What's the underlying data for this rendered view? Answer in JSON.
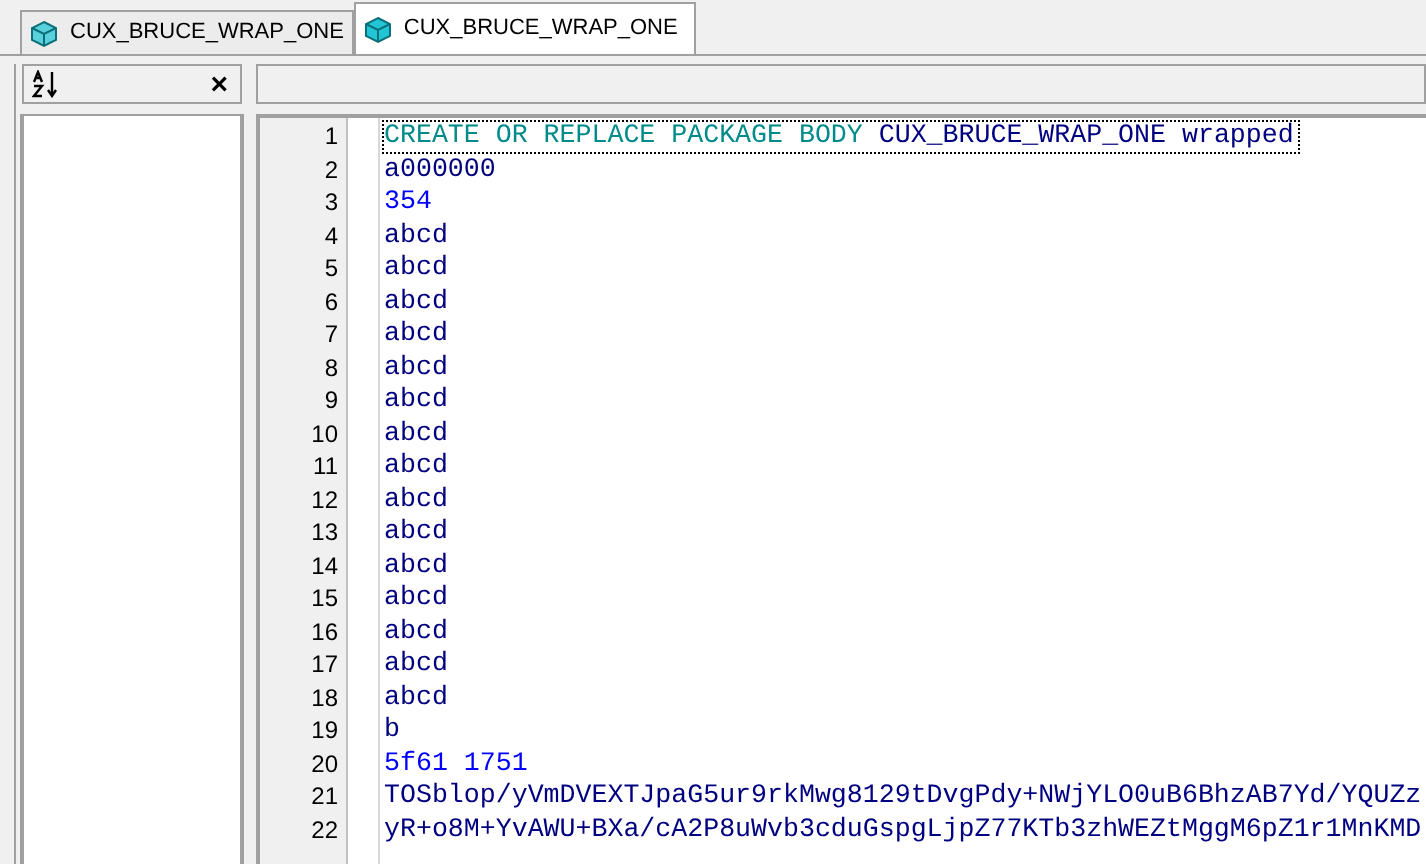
{
  "tabs": [
    {
      "label": "CUX_BRUCE_WRAP_ONE",
      "selected": false
    },
    {
      "label": "CUX_BRUCE_WRAP_ONE",
      "selected": true
    }
  ],
  "outline_panel": {
    "close_label": "×"
  },
  "editor": {
    "lines": [
      {
        "number": "1",
        "current": true,
        "tokens": [
          {
            "text": "CREATE OR REPLACE PACKAGE BODY",
            "kind": "keyword"
          },
          {
            "text": "CUX_BRUCE_WRAP_ONE wrapped",
            "kind": "identifier"
          }
        ]
      },
      {
        "number": "2",
        "current": false,
        "tokens": [
          {
            "text": "a000000",
            "kind": "identifier"
          }
        ]
      },
      {
        "number": "3",
        "current": false,
        "tokens": [
          {
            "text": "354",
            "kind": "number"
          }
        ]
      },
      {
        "number": "4",
        "current": false,
        "tokens": [
          {
            "text": "abcd",
            "kind": "identifier"
          }
        ]
      },
      {
        "number": "5",
        "current": false,
        "tokens": [
          {
            "text": "abcd",
            "kind": "identifier"
          }
        ]
      },
      {
        "number": "6",
        "current": false,
        "tokens": [
          {
            "text": "abcd",
            "kind": "identifier"
          }
        ]
      },
      {
        "number": "7",
        "current": false,
        "tokens": [
          {
            "text": "abcd",
            "kind": "identifier"
          }
        ]
      },
      {
        "number": "8",
        "current": false,
        "tokens": [
          {
            "text": "abcd",
            "kind": "identifier"
          }
        ]
      },
      {
        "number": "9",
        "current": false,
        "tokens": [
          {
            "text": "abcd",
            "kind": "identifier"
          }
        ]
      },
      {
        "number": "10",
        "current": false,
        "tokens": [
          {
            "text": "abcd",
            "kind": "identifier"
          }
        ]
      },
      {
        "number": "11",
        "current": false,
        "tokens": [
          {
            "text": "abcd",
            "kind": "identifier"
          }
        ]
      },
      {
        "number": "12",
        "current": false,
        "tokens": [
          {
            "text": "abcd",
            "kind": "identifier"
          }
        ]
      },
      {
        "number": "13",
        "current": false,
        "tokens": [
          {
            "text": "abcd",
            "kind": "identifier"
          }
        ]
      },
      {
        "number": "14",
        "current": false,
        "tokens": [
          {
            "text": "abcd",
            "kind": "identifier"
          }
        ]
      },
      {
        "number": "15",
        "current": false,
        "tokens": [
          {
            "text": "abcd",
            "kind": "identifier"
          }
        ]
      },
      {
        "number": "16",
        "current": false,
        "tokens": [
          {
            "text": "abcd",
            "kind": "identifier"
          }
        ]
      },
      {
        "number": "17",
        "current": false,
        "tokens": [
          {
            "text": "abcd",
            "kind": "identifier"
          }
        ]
      },
      {
        "number": "18",
        "current": false,
        "tokens": [
          {
            "text": "abcd",
            "kind": "identifier"
          }
        ]
      },
      {
        "number": "19",
        "current": false,
        "tokens": [
          {
            "text": "b",
            "kind": "identifier"
          }
        ]
      },
      {
        "number": "20",
        "current": false,
        "tokens": [
          {
            "text": "5f61 1751",
            "kind": "number"
          }
        ]
      },
      {
        "number": "21",
        "current": false,
        "tokens": [
          {
            "text": "TOSblop/yVmDVEXTJpaG5ur9rkMwg8129tDvgPdy+NWjYLO0uB6BhzAB7Yd/YQUZz",
            "kind": "identifier"
          }
        ]
      },
      {
        "number": "22",
        "current": false,
        "tokens": [
          {
            "text": "yR+o8M+YvAWU+BXa/cA2P8uWvb3cduGspgLjpZ77KTb3zhWEZtMggM6pZ1r1MnKMD",
            "kind": "identifier"
          }
        ]
      }
    ]
  }
}
